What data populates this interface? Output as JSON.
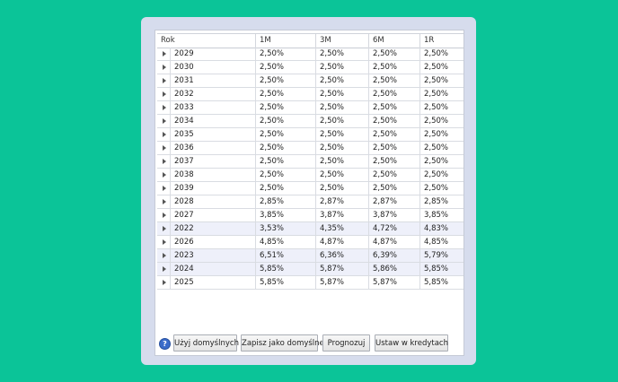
{
  "table": {
    "headers": [
      "Rok",
      "1M",
      "3M",
      "6M",
      "1R"
    ],
    "rows": [
      {
        "year": "2029",
        "m1": "2,50%",
        "m3": "2,50%",
        "m6": "2,50%",
        "r1": "2,50%"
      },
      {
        "year": "2030",
        "m1": "2,50%",
        "m3": "2,50%",
        "m6": "2,50%",
        "r1": "2,50%"
      },
      {
        "year": "2031",
        "m1": "2,50%",
        "m3": "2,50%",
        "m6": "2,50%",
        "r1": "2,50%"
      },
      {
        "year": "2032",
        "m1": "2,50%",
        "m3": "2,50%",
        "m6": "2,50%",
        "r1": "2,50%"
      },
      {
        "year": "2033",
        "m1": "2,50%",
        "m3": "2,50%",
        "m6": "2,50%",
        "r1": "2,50%"
      },
      {
        "year": "2034",
        "m1": "2,50%",
        "m3": "2,50%",
        "m6": "2,50%",
        "r1": "2,50%"
      },
      {
        "year": "2035",
        "m1": "2,50%",
        "m3": "2,50%",
        "m6": "2,50%",
        "r1": "2,50%"
      },
      {
        "year": "2036",
        "m1": "2,50%",
        "m3": "2,50%",
        "m6": "2,50%",
        "r1": "2,50%"
      },
      {
        "year": "2037",
        "m1": "2,50%",
        "m3": "2,50%",
        "m6": "2,50%",
        "r1": "2,50%"
      },
      {
        "year": "2038",
        "m1": "2,50%",
        "m3": "2,50%",
        "m6": "2,50%",
        "r1": "2,50%"
      },
      {
        "year": "2039",
        "m1": "2,50%",
        "m3": "2,50%",
        "m6": "2,50%",
        "r1": "2,50%"
      },
      {
        "year": "2028",
        "m1": "2,85%",
        "m3": "2,87%",
        "m6": "2,87%",
        "r1": "2,85%"
      },
      {
        "year": "2027",
        "m1": "3,85%",
        "m3": "3,87%",
        "m6": "3,87%",
        "r1": "3,85%"
      },
      {
        "year": "2022",
        "m1": "3,53%",
        "m3": "4,35%",
        "m6": "4,72%",
        "r1": "4,83%",
        "selected": true
      },
      {
        "year": "2026",
        "m1": "4,85%",
        "m3": "4,87%",
        "m6": "4,87%",
        "r1": "4,85%"
      },
      {
        "year": "2023",
        "m1": "6,51%",
        "m3": "6,36%",
        "m6": "6,39%",
        "r1": "5,79%",
        "selected": true
      },
      {
        "year": "2024",
        "m1": "5,85%",
        "m3": "5,87%",
        "m6": "5,86%",
        "r1": "5,85%",
        "selected": true
      },
      {
        "year": "2025",
        "m1": "5,85%",
        "m3": "5,87%",
        "m6": "5,87%",
        "r1": "5,85%"
      }
    ]
  },
  "toolbar": {
    "help_label": "?",
    "use_defaults_label": "Użyj domyślnych",
    "save_default_label": "Zapisz jako domyślne",
    "forecast_label": "Prognozuj",
    "set_in_credits_label": "Ustaw w kredytach"
  }
}
